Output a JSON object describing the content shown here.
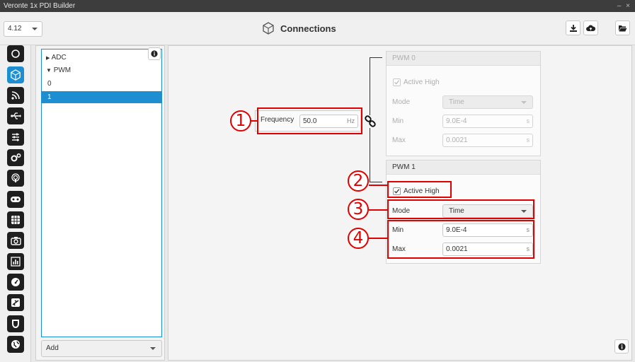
{
  "window": {
    "title": "Veronte 1x PDI Builder",
    "controls": "– ×"
  },
  "header": {
    "version": "4.12",
    "page_title": "Connections"
  },
  "tree": {
    "items": [
      {
        "label": "ADC",
        "arrow": "▶"
      },
      {
        "label": "PWM",
        "arrow": "▼"
      },
      {
        "label": "0"
      },
      {
        "label": "1"
      }
    ],
    "add_label": "Add"
  },
  "frequency": {
    "label": "Frequency",
    "value": "50.0",
    "unit": "Hz"
  },
  "pwm0": {
    "title": "PWM 0",
    "active_high": "Active High",
    "mode_label": "Mode",
    "mode_value": "Time",
    "min_label": "Min",
    "min_value": "9.0E-4",
    "min_unit": "s",
    "max_label": "Max",
    "max_value": "0.0021",
    "max_unit": "s"
  },
  "pwm1": {
    "title": "PWM 1",
    "active_high": "Active High",
    "mode_label": "Mode",
    "mode_value": "Time",
    "min_label": "Min",
    "min_value": "9.0E-4",
    "min_unit": "s",
    "max_label": "Max",
    "max_value": "0.0021",
    "max_unit": "s"
  },
  "callouts": [
    "1",
    "2",
    "3",
    "4"
  ],
  "colors": {
    "accent": "#1d8fd1",
    "annotation": "#e10000"
  }
}
